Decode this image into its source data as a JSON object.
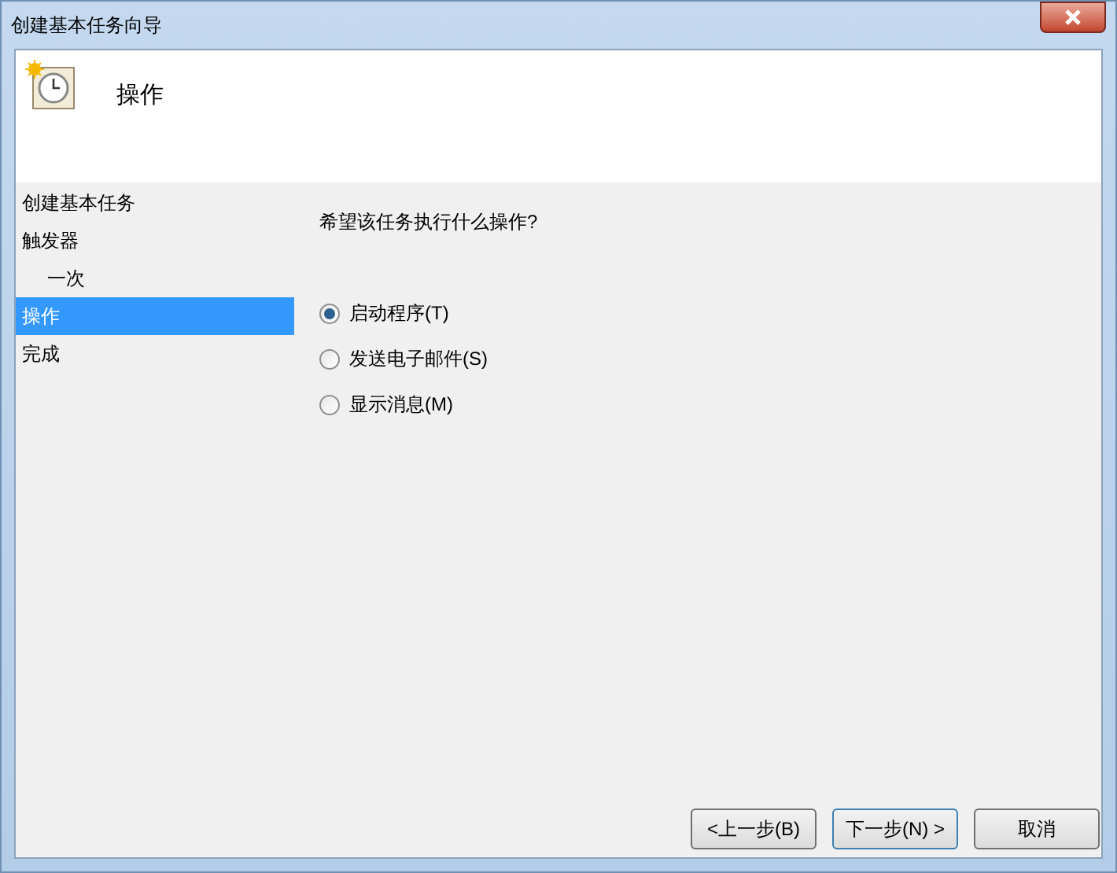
{
  "window": {
    "title": "创建基本任务向导"
  },
  "header": {
    "title": "操作"
  },
  "steps": [
    {
      "label": "创建基本任务",
      "selected": false
    },
    {
      "label": "触发器",
      "selected": false,
      "children": [
        {
          "label": "一次",
          "selected": false
        }
      ]
    },
    {
      "label": "操作",
      "selected": true
    },
    {
      "label": "完成",
      "selected": false
    }
  ],
  "question": "希望该任务执行什么操作?",
  "options": [
    {
      "label": "启动程序(T)",
      "selected": true
    },
    {
      "label": "发送电子邮件(S)",
      "selected": false
    },
    {
      "label": "显示消息(M)",
      "selected": false
    }
  ],
  "buttons": [
    "<上一步(B)",
    "下一步(N) >",
    "取消"
  ]
}
